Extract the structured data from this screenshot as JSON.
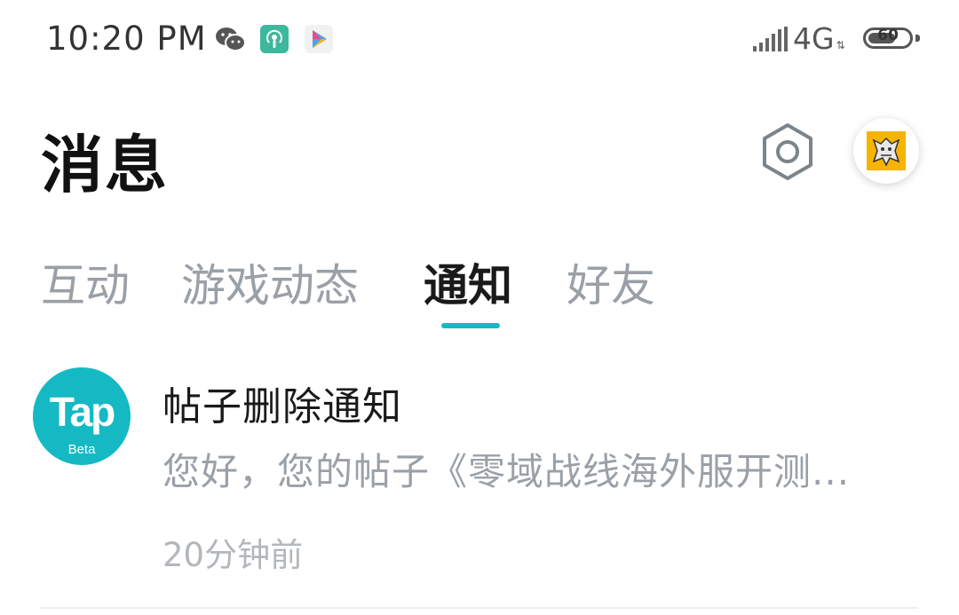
{
  "status_bar": {
    "time": "10:20 PM",
    "icons": [
      "wechat-icon",
      "podcast-icon",
      "play-store-icon"
    ],
    "network": "4G",
    "battery": "60"
  },
  "header": {
    "title": "消息",
    "settings_icon": "gear-icon",
    "avatar": "user-avatar"
  },
  "tabs": [
    {
      "label": "互动",
      "active": false
    },
    {
      "label": "游戏动态",
      "active": false
    },
    {
      "label": "通知",
      "active": true
    },
    {
      "label": "好友",
      "active": false
    }
  ],
  "notifications": [
    {
      "logo_text": "Tap",
      "logo_badge": "Beta",
      "title": "帖子删除通知",
      "body": "您好，您的帖子《零域战线海外服开测...",
      "time": "20分钟前"
    }
  ],
  "colors": {
    "accent": "#14b9c8",
    "tap_logo": "#15b9c4",
    "muted_text": "#9aa0a6"
  }
}
